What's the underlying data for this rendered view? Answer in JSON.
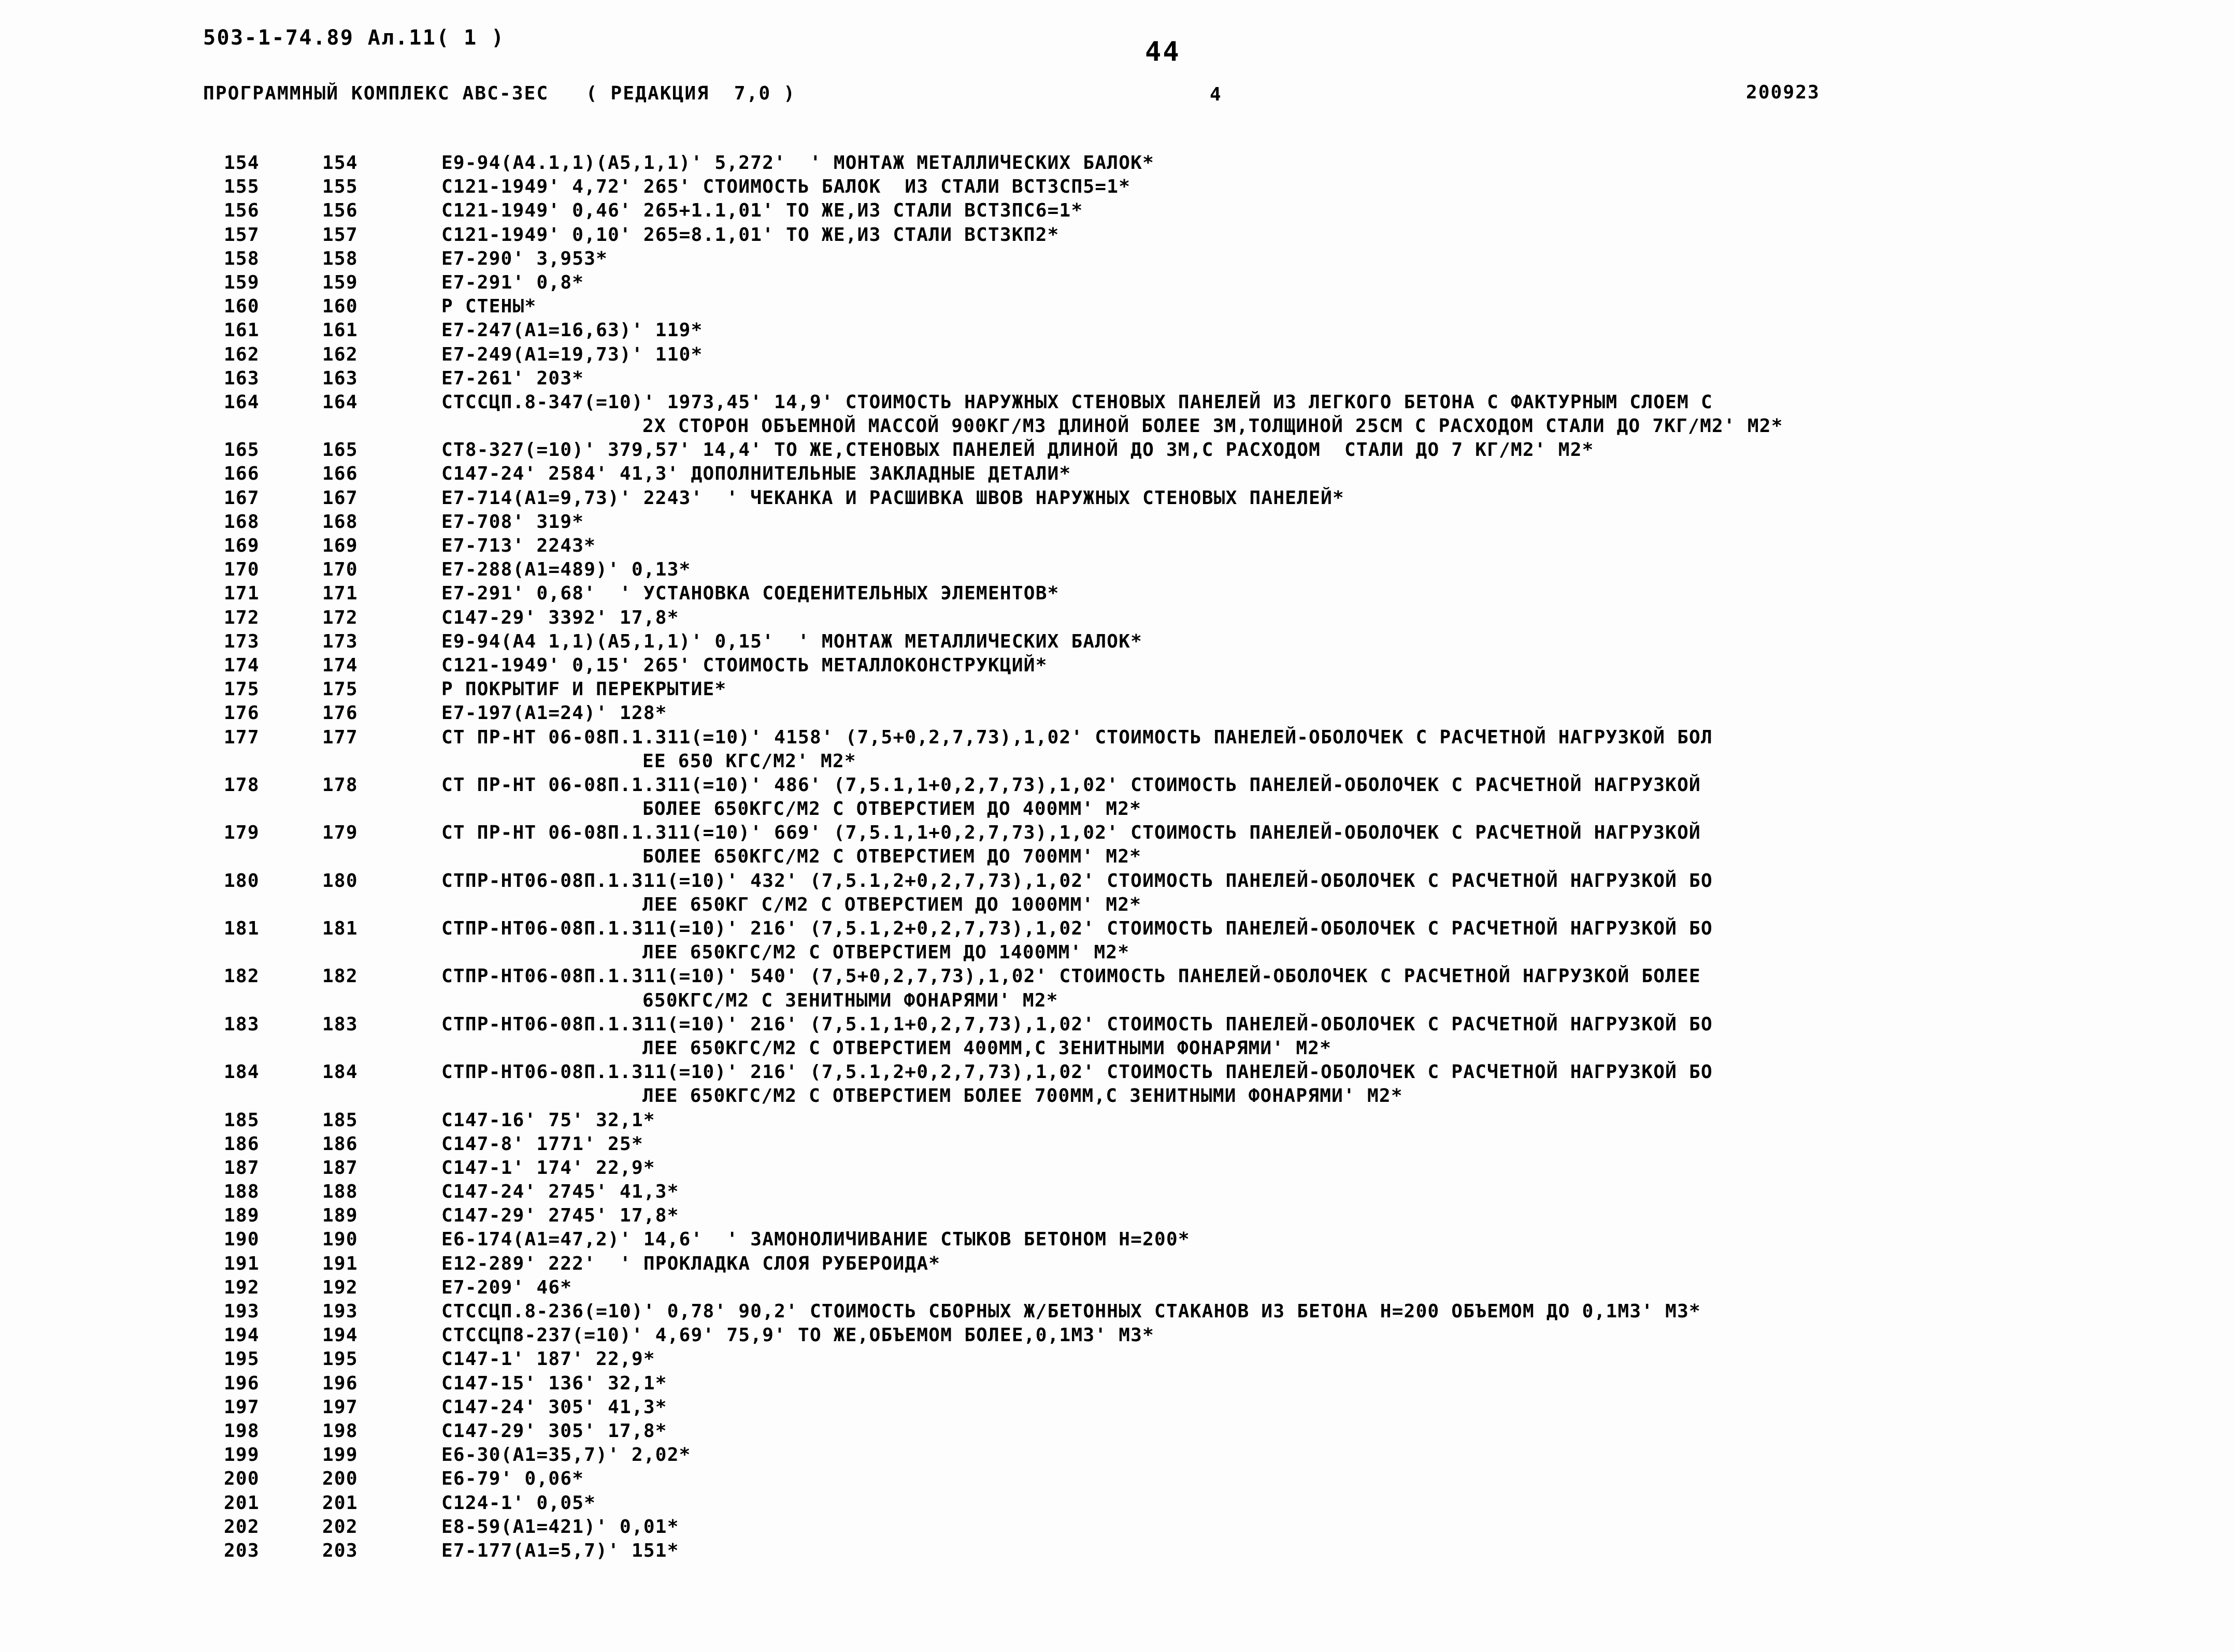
{
  "header": {
    "doc_code": "503-1-74.89 Ал.11( 1 )",
    "page_number": "44",
    "program_line": "ПРОГРАММНЫЙ КОМПЛЕКС АВС-3ЕС   ( РЕДАКЦИЯ  7,0 )",
    "sheet_number": "4",
    "date_code": "200923"
  },
  "listing": {
    "rows": [
      {
        "n1": "154",
        "n2": "154",
        "text": "E9-94(A4.1,1)(A5,1,1)' 5,272'  ' МОНТАЖ МЕТАЛЛИЧЕСКИХ БАЛОК*",
        "cont": false,
        "indent": 0
      },
      {
        "n1": "155",
        "n2": "155",
        "text": "C121-1949' 4,72' 265' СТОИМОСТЬ БАЛОК  ИЗ СТАЛИ ВСТ3СП5=1*",
        "cont": false,
        "indent": 0
      },
      {
        "n1": "156",
        "n2": "156",
        "text": "C121-1949' 0,46' 265+1.1,01' ТО ЖЕ,ИЗ СТАЛИ ВСТ3ПС6=1*",
        "cont": false,
        "indent": 0
      },
      {
        "n1": "157",
        "n2": "157",
        "text": "C121-1949' 0,10' 265=8.1,01' ТО ЖЕ,ИЗ СТАЛИ ВСТ3КП2*",
        "cont": false,
        "indent": 0
      },
      {
        "n1": "158",
        "n2": "158",
        "text": "E7-290' 3,953*",
        "cont": false,
        "indent": 0
      },
      {
        "n1": "159",
        "n2": "159",
        "text": "E7-291' 0,8*",
        "cont": false,
        "indent": 0
      },
      {
        "n1": "160",
        "n2": "160",
        "text": "P СТЕНЫ*",
        "cont": false,
        "indent": 0
      },
      {
        "n1": "161",
        "n2": "161",
        "text": "E7-247(A1=16,63)' 119*",
        "cont": false,
        "indent": 0
      },
      {
        "n1": "162",
        "n2": "162",
        "text": "E7-249(A1=19,73)' 110*",
        "cont": false,
        "indent": 0
      },
      {
        "n1": "163",
        "n2": "163",
        "text": "E7-261' 203*",
        "cont": false,
        "indent": 0
      },
      {
        "n1": "164",
        "n2": "164",
        "text": "СТССЦП.8-347(=10)' 1973,45' 14,9' СТОИМОСТЬ НАРУЖНЫХ СТЕНОВЫХ ПАНЕЛЕЙ ИЗ ЛЕГКОГО БЕТОНА С ФАКТУРНЫМ СЛОЕМ С",
        "cont": false,
        "indent": 0
      },
      {
        "n1": "",
        "n2": "",
        "text": "2Х СТОРОН ОБЪЕМНОЙ МАССОЙ 900КГ/М3 ДЛИНОЙ БОЛЕЕ 3М,ТОЛЩИНОЙ 25СМ С РАСХОДОМ СТАЛИ ДО 7КГ/М2' М2*",
        "cont": true,
        "indent": 388
      },
      {
        "n1": "165",
        "n2": "165",
        "text": "СТ8-327(=10)' 379,57' 14,4' ТО ЖЕ,СТЕНОВЫХ ПАНЕЛЕЙ ДЛИНОЙ ДО 3М,С РАСХОДОМ  СТАЛИ ДО 7 КГ/М2' М2*",
        "cont": false,
        "indent": 0
      },
      {
        "n1": "166",
        "n2": "166",
        "text": "C147-24' 2584' 41,3' ДОПОЛНИТЕЛЬНЫЕ ЗАКЛАДНЫЕ ДЕТАЛИ*",
        "cont": false,
        "indent": 0
      },
      {
        "n1": "167",
        "n2": "167",
        "text": "E7-714(A1=9,73)' 2243'  ' ЧЕКАНКА И РАСШИВКА ШВОВ НАРУЖНЫХ СТЕНОВЫХ ПАНЕЛЕЙ*",
        "cont": false,
        "indent": 0
      },
      {
        "n1": "168",
        "n2": "168",
        "text": "E7-708' 319*",
        "cont": false,
        "indent": 0
      },
      {
        "n1": "169",
        "n2": "169",
        "text": "E7-713' 2243*",
        "cont": false,
        "indent": 0
      },
      {
        "n1": "170",
        "n2": "170",
        "text": "E7-288(A1=489)' 0,13*",
        "cont": false,
        "indent": 0
      },
      {
        "n1": "171",
        "n2": "171",
        "text": "E7-291' 0,68'  ' УСТАНОВКА СОЕДЕНИТЕЛЬНЫХ ЭЛЕМЕНТОВ*",
        "cont": false,
        "indent": 0
      },
      {
        "n1": "172",
        "n2": "172",
        "text": "C147-29' 3392' 17,8*",
        "cont": false,
        "indent": 0
      },
      {
        "n1": "173",
        "n2": "173",
        "text": "E9-94(A4 1,1)(A5,1,1)' 0,15'  ' МОНТАЖ МЕТАЛЛИЧЕСКИХ БАЛОК*",
        "cont": false,
        "indent": 0
      },
      {
        "n1": "174",
        "n2": "174",
        "text": "C121-1949' 0,15' 265' СТОИМОСТЬ МЕТАЛЛОКОНСТРУКЦИЙ*",
        "cont": false,
        "indent": 0
      },
      {
        "n1": "175",
        "n2": "175",
        "text": "P ПОКРЫТИF И ПЕРЕКРЫТИЕ*",
        "cont": false,
        "indent": 0
      },
      {
        "n1": "176",
        "n2": "176",
        "text": "E7-197(A1=24)' 128*",
        "cont": false,
        "indent": 0
      },
      {
        "n1": "177",
        "n2": "177",
        "text": "СТ ПР-НТ 06-08П.1.311(=10)' 4158' (7,5+0,2,7,73),1,02' СТОИМОСТЬ ПАНЕЛЕЙ-ОБОЛОЧЕК С РАСЧЕТНОЙ НАГРУЗКОЙ БОЛ",
        "cont": false,
        "indent": 0
      },
      {
        "n1": "",
        "n2": "",
        "text": "ЕЕ 650 КГС/М2' М2*",
        "cont": true,
        "indent": 388
      },
      {
        "n1": "178",
        "n2": "178",
        "text": "СТ ПР-НТ 06-08П.1.311(=10)' 486' (7,5.1,1+0,2,7,73),1,02' СТОИМОСТЬ ПАНЕЛЕЙ-ОБОЛОЧЕК С РАСЧЕТНОЙ НАГРУЗКОЙ",
        "cont": false,
        "indent": 0
      },
      {
        "n1": "",
        "n2": "",
        "text": "БОЛЕЕ 650КГС/М2 С ОТВЕРСТИЕМ ДО 400ММ' М2*",
        "cont": true,
        "indent": 388
      },
      {
        "n1": "179",
        "n2": "179",
        "text": "СТ ПР-НТ 06-08П.1.311(=10)' 669' (7,5.1,1+0,2,7,73),1,02' СТОИМОСТЬ ПАНЕЛЕЙ-ОБОЛОЧЕК С РАСЧЕТНОЙ НАГРУЗКОЙ",
        "cont": false,
        "indent": 0
      },
      {
        "n1": "",
        "n2": "",
        "text": "БОЛЕЕ 650КГС/М2 С ОТВЕРСТИЕМ ДО 700ММ' М2*",
        "cont": true,
        "indent": 388
      },
      {
        "n1": "180",
        "n2": "180",
        "text": "СТПР-НТ06-08П.1.311(=10)' 432' (7,5.1,2+0,2,7,73),1,02' СТОИМОСТЬ ПАНЕЛЕЙ-ОБОЛОЧЕК С РАСЧЕТНОЙ НАГРУЗКОЙ БО",
        "cont": false,
        "indent": 0
      },
      {
        "n1": "",
        "n2": "",
        "text": "ЛЕЕ 650КГ С/М2 С ОТВЕРСТИЕМ ДО 1000ММ' М2*",
        "cont": true,
        "indent": 388
      },
      {
        "n1": "181",
        "n2": "181",
        "text": "СТПР-НТ06-08П.1.311(=10)' 216' (7,5.1,2+0,2,7,73),1,02' СТОИМОСТЬ ПАНЕЛЕЙ-ОБОЛОЧЕК С РАСЧЕТНОЙ НАГРУЗКОЙ БО",
        "cont": false,
        "indent": 0
      },
      {
        "n1": "",
        "n2": "",
        "text": "ЛЕЕ 650КГС/М2 С ОТВЕРСТИЕМ ДО 1400ММ' М2*",
        "cont": true,
        "indent": 388
      },
      {
        "n1": "182",
        "n2": "182",
        "text": "СТПР-НТ06-08П.1.311(=10)' 540' (7,5+0,2,7,73),1,02' СТОИМОСТЬ ПАНЕЛЕЙ-ОБОЛОЧЕК С РАСЧЕТНОЙ НАГРУЗКОЙ БОЛЕЕ",
        "cont": false,
        "indent": 0
      },
      {
        "n1": "",
        "n2": "",
        "text": "650КГС/М2 С ЗЕНИТНЫМИ ФОНАРЯМИ' М2*",
        "cont": true,
        "indent": 388
      },
      {
        "n1": "183",
        "n2": "183",
        "text": "СТПР-НТ06-08П.1.311(=10)' 216' (7,5.1,1+0,2,7,73),1,02' СТОИМОСТЬ ПАНЕЛЕЙ-ОБОЛОЧЕК С РАСЧЕТНОЙ НАГРУЗКОЙ БО",
        "cont": false,
        "indent": 0
      },
      {
        "n1": "",
        "n2": "",
        "text": "ЛЕЕ 650КГС/М2 С ОТВЕРСТИЕМ 400ММ,С ЗЕНИТНЫМИ ФОНАРЯМИ' М2*",
        "cont": true,
        "indent": 388
      },
      {
        "n1": "184",
        "n2": "184",
        "text": "СТПР-НТ06-08П.1.311(=10)' 216' (7,5.1,2+0,2,7,73),1,02' СТОИМОСТЬ ПАНЕЛЕЙ-ОБОЛОЧЕК С РАСЧЕТНОЙ НАГРУЗКОЙ БО",
        "cont": false,
        "indent": 0
      },
      {
        "n1": "",
        "n2": "",
        "text": "ЛЕЕ 650КГС/М2 С ОТВЕРСТИЕМ БОЛЕЕ 700ММ,С ЗЕНИТНЫМИ ФОНАРЯМИ' М2*",
        "cont": true,
        "indent": 388
      },
      {
        "n1": "185",
        "n2": "185",
        "text": "C147-16' 75' 32,1*",
        "cont": false,
        "indent": 0
      },
      {
        "n1": "186",
        "n2": "186",
        "text": "C147-8' 1771' 25*",
        "cont": false,
        "indent": 0
      },
      {
        "n1": "187",
        "n2": "187",
        "text": "C147-1' 174' 22,9*",
        "cont": false,
        "indent": 0
      },
      {
        "n1": "188",
        "n2": "188",
        "text": "C147-24' 2745' 41,3*",
        "cont": false,
        "indent": 0
      },
      {
        "n1": "189",
        "n2": "189",
        "text": "C147-29' 2745' 17,8*",
        "cont": false,
        "indent": 0
      },
      {
        "n1": "190",
        "n2": "190",
        "text": "E6-174(A1=47,2)' 14,6'  ' ЗАМОНОЛИЧИВАНИЕ СТЫКОВ БЕТОНОМ H=200*",
        "cont": false,
        "indent": 0
      },
      {
        "n1": "191",
        "n2": "191",
        "text": "E12-289' 222'  ' ПРОКЛАДКА СЛОЯ РУБЕРОИДА*",
        "cont": false,
        "indent": 0
      },
      {
        "n1": "192",
        "n2": "192",
        "text": "E7-209' 46*",
        "cont": false,
        "indent": 0
      },
      {
        "n1": "193",
        "n2": "193",
        "text": "СТССЦП.8-236(=10)' 0,78' 90,2' СТОИМОСТЬ СБОРНЫХ Ж/БЕТОННЫХ СТАКАНОВ ИЗ БЕТОНА H=200 ОБЪЕМОМ ДО 0,1М3' М3*",
        "cont": false,
        "indent": 0
      },
      {
        "n1": "194",
        "n2": "194",
        "text": "СТССЦП8-237(=10)' 4,69' 75,9' ТО ЖЕ,ОБЪЕМОМ БОЛЕЕ,0,1М3' М3*",
        "cont": false,
        "indent": 0
      },
      {
        "n1": "195",
        "n2": "195",
        "text": "C147-1' 187' 22,9*",
        "cont": false,
        "indent": 0
      },
      {
        "n1": "196",
        "n2": "196",
        "text": "C147-15' 136' 32,1*",
        "cont": false,
        "indent": 0
      },
      {
        "n1": "197",
        "n2": "197",
        "text": "C147-24' 305' 41,3*",
        "cont": false,
        "indent": 0
      },
      {
        "n1": "198",
        "n2": "198",
        "text": "C147-29' 305' 17,8*",
        "cont": false,
        "indent": 0
      },
      {
        "n1": "199",
        "n2": "199",
        "text": "E6-30(A1=35,7)' 2,02*",
        "cont": false,
        "indent": 0
      },
      {
        "n1": "200",
        "n2": "200",
        "text": "E6-79' 0,06*",
        "cont": false,
        "indent": 0
      },
      {
        "n1": "201",
        "n2": "201",
        "text": "C124-1' 0,05*",
        "cont": false,
        "indent": 0
      },
      {
        "n1": "202",
        "n2": "202",
        "text": "E8-59(A1=421)' 0,01*",
        "cont": false,
        "indent": 0
      },
      {
        "n1": "203",
        "n2": "203",
        "text": "E7-177(A1=5,7)' 151*",
        "cont": false,
        "indent": 0
      }
    ]
  }
}
